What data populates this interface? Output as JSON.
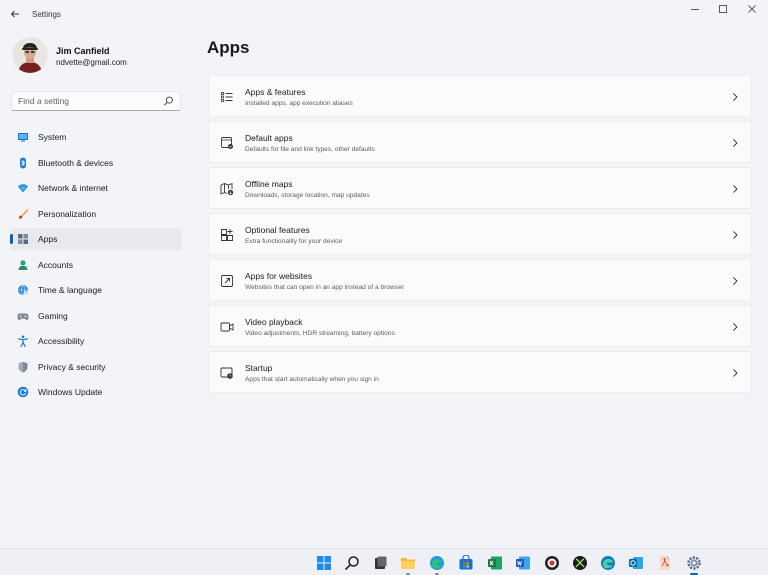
{
  "window": {
    "title": "Settings"
  },
  "profile": {
    "name": "Jim Canfield",
    "email": "ndvette@gmail.com"
  },
  "search": {
    "placeholder": "Find a setting"
  },
  "nav": {
    "items": [
      {
        "label": "System",
        "icon": "system-icon"
      },
      {
        "label": "Bluetooth & devices",
        "icon": "bluetooth-icon"
      },
      {
        "label": "Network & internet",
        "icon": "network-icon"
      },
      {
        "label": "Personalization",
        "icon": "brush-icon"
      },
      {
        "label": "Apps",
        "icon": "apps-icon",
        "selected": true
      },
      {
        "label": "Accounts",
        "icon": "accounts-icon"
      },
      {
        "label": "Time & language",
        "icon": "globe-clock-icon"
      },
      {
        "label": "Gaming",
        "icon": "gamepad-icon"
      },
      {
        "label": "Accessibility",
        "icon": "accessibility-icon"
      },
      {
        "label": "Privacy & security",
        "icon": "shield-icon"
      },
      {
        "label": "Windows Update",
        "icon": "update-icon"
      }
    ]
  },
  "main": {
    "title": "Apps",
    "cards": [
      {
        "title": "Apps & features",
        "description": "Installed apps, app execution aliases",
        "icon": "list-icon"
      },
      {
        "title": "Default apps",
        "description": "Defaults for file and link types, other defaults",
        "icon": "default-apps-icon"
      },
      {
        "title": "Offline maps",
        "description": "Downloads, storage location, map updates",
        "icon": "map-icon"
      },
      {
        "title": "Optional features",
        "description": "Extra functionality for your device",
        "icon": "grid-plus-icon"
      },
      {
        "title": "Apps for websites",
        "description": "Websites that can open in an app instead of a browser",
        "icon": "web-link-icon"
      },
      {
        "title": "Video playback",
        "description": "Video adjustments, HDR streaming, battery options",
        "icon": "video-icon"
      },
      {
        "title": "Startup",
        "description": "Apps that start automatically when you sign in",
        "icon": "startup-icon"
      }
    ]
  },
  "taskbar": {
    "items": [
      {
        "icon": "windows-start-icon"
      },
      {
        "icon": "search-icon"
      },
      {
        "icon": "task-view-icon"
      },
      {
        "icon": "file-explorer-icon"
      },
      {
        "icon": "edge-icon"
      },
      {
        "icon": "store-icon"
      },
      {
        "icon": "excel-icon"
      },
      {
        "icon": "word-icon"
      },
      {
        "icon": "media-app-icon"
      },
      {
        "icon": "xbox-icon"
      },
      {
        "icon": "edge-dev-icon"
      },
      {
        "icon": "outlook-icon"
      },
      {
        "icon": "pdf-icon"
      },
      {
        "icon": "settings-gear-icon",
        "active": true
      }
    ]
  },
  "colors": {
    "accent": "#0067c0",
    "background": "#f3f4f8",
    "card": "#fbfbfc"
  }
}
